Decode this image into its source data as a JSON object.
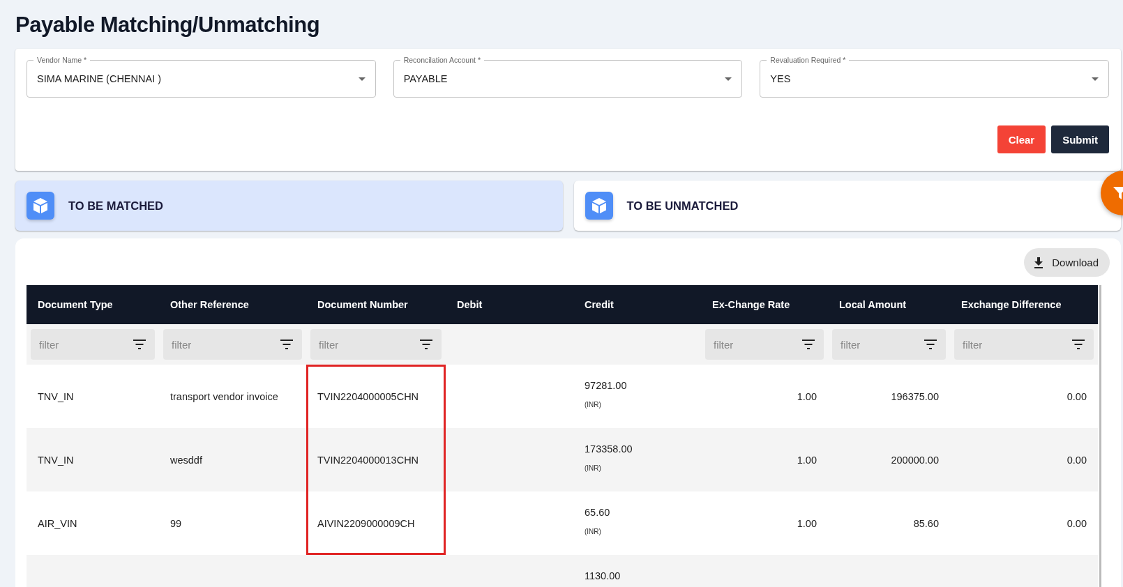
{
  "title": "Payable Matching/Unmatching",
  "form": {
    "fields": [
      {
        "label": "Vendor Name *",
        "value": "SIMA MARINE (CHENNAI )"
      },
      {
        "label": "Reconcilation Account *",
        "value": "PAYABLE"
      },
      {
        "label": "Revaluation Required *",
        "value": "YES"
      }
    ],
    "buttons": [
      {
        "label": "Clear",
        "kind": "danger"
      },
      {
        "label": "Submit",
        "kind": "primary"
      }
    ]
  },
  "tabs": [
    {
      "label": "TO BE MATCHED",
      "selected": true
    },
    {
      "label": "TO BE UNMATCHED",
      "selected": false
    }
  ],
  "download_button": "Download",
  "table": {
    "columns": [
      {
        "label": "Document Type",
        "filter": "filter",
        "kind": "text"
      },
      {
        "label": "Other Reference",
        "filter": "filter",
        "kind": "text"
      },
      {
        "label": "Document Number",
        "filter": "filter",
        "kind": "text"
      },
      {
        "label": "Debit",
        "kind": "text"
      },
      {
        "label": "Credit",
        "kind": "amount"
      },
      {
        "label": "Ex-Change Rate",
        "filter": "filter",
        "kind": "number"
      },
      {
        "label": "Local Amount",
        "filter": "filter",
        "kind": "number"
      },
      {
        "label": "Exchange Difference",
        "filter": "filter",
        "kind": "number"
      }
    ],
    "rows": [
      {
        "cells": [
          "TNV_IN",
          "transport vendor invoice",
          {
            "text": "TVIN2204000005CHN",
            "highlighted": true
          },
          "",
          {
            "amount": "97281.00",
            "currency": "(INR)"
          },
          "1.00",
          "196375.00",
          "0.00"
        ]
      },
      {
        "cells": [
          "TNV_IN",
          "wesddf",
          {
            "text": "TVIN2204000013CHN",
            "highlighted": true
          },
          "",
          {
            "amount": "173358.00",
            "currency": "(INR)"
          },
          "1.00",
          "200000.00",
          "0.00"
        ]
      },
      {
        "cells": [
          "AIR_VIN",
          "99",
          {
            "text": "AIVIN2209000009CH",
            "highlighted": true
          },
          "",
          {
            "amount": "65.60",
            "currency": "(INR)"
          },
          "1.00",
          "85.60",
          "0.00"
        ]
      },
      {
        "cells": [
          "",
          "",
          "",
          "",
          {
            "amount": "1130.00"
          },
          "",
          "",
          ""
        ]
      }
    ]
  }
}
